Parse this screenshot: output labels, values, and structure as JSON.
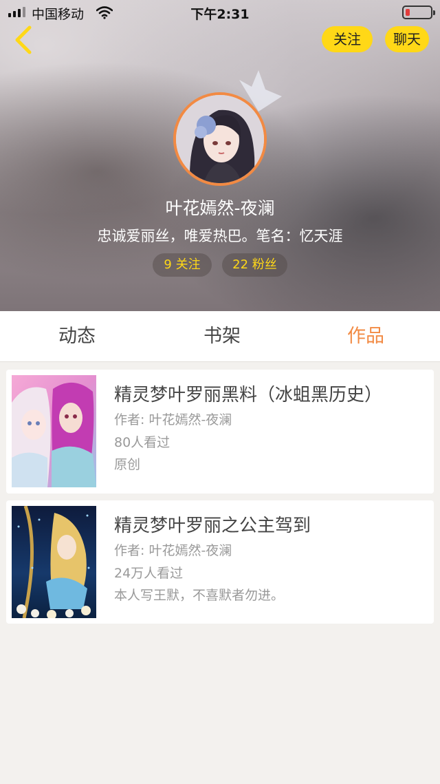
{
  "status_bar": {
    "carrier": "中国移动",
    "time": "下午2:31"
  },
  "nav": {
    "follow_label": "关注",
    "chat_label": "聊天"
  },
  "profile": {
    "name": "叶花嫣然-夜澜",
    "bio": "忠诚爱丽丝，唯爱热巴。笔名：忆天涯",
    "following_label": "9 关注",
    "fans_label": "22 粉丝"
  },
  "tabs": [
    {
      "label": "动态",
      "active": false
    },
    {
      "label": "书架",
      "active": false
    },
    {
      "label": "作品",
      "active": true
    }
  ],
  "works": [
    {
      "title": "精灵梦叶罗丽黑料（冰蛆黑历史）",
      "author": "作者: 叶花嫣然-夜澜",
      "views": "80人看过",
      "tag": "原创"
    },
    {
      "title": "精灵梦叶罗丽之公主驾到",
      "author": "作者: 叶花嫣然-夜澜",
      "views": "24万人看过",
      "tag": "本人写王默，不喜默者勿进。"
    }
  ],
  "colors": {
    "accent": "#f28a43",
    "button_yellow": "#ffd817",
    "battery_low": "#e23c3c"
  },
  "icons": [
    "signal-icon",
    "wifi-icon",
    "battery-icon",
    "back-arrow-icon",
    "crown-icon"
  ]
}
